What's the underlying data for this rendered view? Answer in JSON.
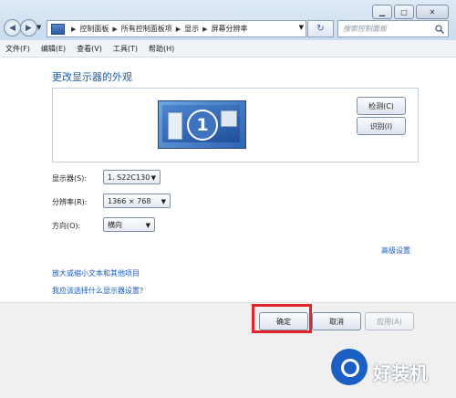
{
  "window": {
    "breadcrumbs": [
      "控制面板",
      "所有控制面板项",
      "显示",
      "屏幕分辨率"
    ],
    "search_placeholder": "搜索控制面板"
  },
  "menu": [
    "文件(F)",
    "编辑(E)",
    "查看(V)",
    "工具(T)",
    "帮助(H)"
  ],
  "heading": "更改显示器的外观",
  "preview": {
    "monitor_number": "1"
  },
  "buttons": {
    "detect": "检测(C)",
    "identify": "识别(I)",
    "ok": "确定",
    "cancel": "取消",
    "apply": "应用(A)"
  },
  "settings": {
    "display_label": "显示器(S):",
    "display_value": "1. S22C130",
    "resolution_label": "分辨率(R):",
    "resolution_value": "1366 × 768",
    "orientation_label": "方向(O):",
    "orientation_value": "横向"
  },
  "links": {
    "advanced": "高级设置",
    "text_size": "放大或缩小文本和其他项目",
    "which_settings": "我应该选择什么显示器设置?"
  },
  "watermark": "好装机"
}
